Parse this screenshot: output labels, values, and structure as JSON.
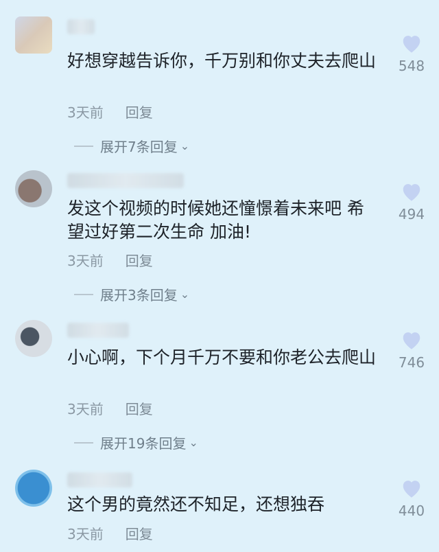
{
  "comments": [
    {
      "text": "好想穿越告诉你，千万别和你丈夫去爬山",
      "time": "3天前",
      "reply": "回复",
      "likes": "548",
      "expand": "展开7条回复"
    },
    {
      "text": "发这个视频的时候她还憧憬着未来吧 希望过好第二次生命 加油!",
      "time": "3天前",
      "reply": "回复",
      "likes": "494",
      "expand": "展开3条回复"
    },
    {
      "text": "小心啊，下个月千万不要和你老公去爬山",
      "time": "3天前",
      "reply": "回复",
      "likes": "746",
      "expand": "展开19条回复"
    },
    {
      "text": "这个男的竟然还不知足，还想独吞",
      "time": "3天前",
      "reply": "回复",
      "likes": "440"
    }
  ],
  "colors": {
    "background": "#dff1fa",
    "heart": "#c3d2f2"
  },
  "icons": {
    "like": "heart-icon",
    "expand": "chevron-down-icon"
  }
}
